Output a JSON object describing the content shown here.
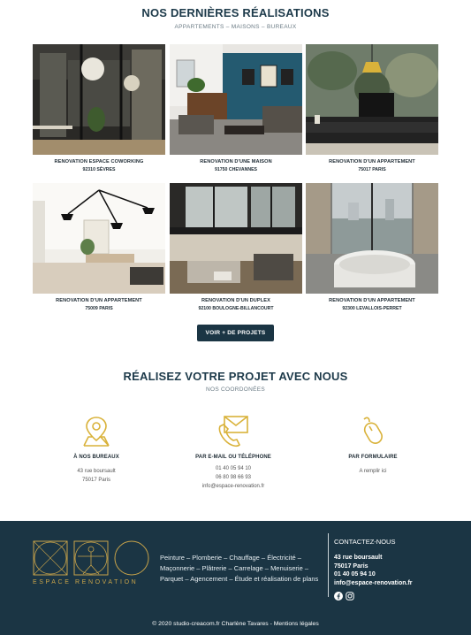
{
  "realisations": {
    "title": "NOS DERNIÈRES RÉALISATIONS",
    "subtitle": "APPARTEMENTS – MAISONS – BUREAUX",
    "projects": [
      {
        "title": "RENOVATION ESPACE COWORKING",
        "location": "92310 SÈVRES"
      },
      {
        "title": "RENOVATION D'UNE MAISON",
        "location": "91750 CHEVANNES"
      },
      {
        "title": "RENOVATION D'UN APPARTEMENT",
        "location": "75017 PARIS"
      },
      {
        "title": "RENOVATION D'UN APPARTEMENT",
        "location": "75009 PARIS"
      },
      {
        "title": "RENOVATION D'UN DUPLEX",
        "location": "92100 BOULOGNE-BILLANCOURT"
      },
      {
        "title": "RENOVATION D'UN APPARTEMENT",
        "location": "92300 LEVALLOIS-PERRET"
      }
    ],
    "more_button": "VOIR + DE PROJETS"
  },
  "projet": {
    "title": "RÉALISEZ VOTRE PROJET AVEC NOUS",
    "subtitle": "NOS COORDONÉES",
    "bureaux": {
      "heading": "À NOS BUREAUX",
      "line1": "43 rue boursault",
      "line2": "75017 Paris"
    },
    "email_tel": {
      "heading": "PAR E-MAIL OU TÉLÉPHONE",
      "phone1": "01 40 05 94 10",
      "phone2": "06 80 98 66 93",
      "email": "info@espace-renovation.fr"
    },
    "formulaire": {
      "heading": "PAR FORMULAIRE",
      "line1": "A remplir ici"
    }
  },
  "footer": {
    "logo_text": "ESPACE RENOVATION",
    "description": "Peinture – Plomberie – Chauffage – Électricité – Maçonnerie – Plâtrerie – Carrelage – Menuiserie – Parquet – Agencement – Étude et réalisation de plans",
    "contact_title": "CONTACTEZ-NOUS",
    "contact_address1": "43 rue boursault",
    "contact_address2": "75017 Paris",
    "contact_phone": "01 40 05 94 10",
    "contact_email": "info@espace-renovation.fr",
    "copyright": "© 2020 studio-creacom.fr Charlène Tavares - Mentions légales"
  },
  "colors": {
    "navy": "#1b3544",
    "gold": "#d9b23a",
    "title": "#1d3a4a"
  },
  "icons": [
    "map-pin-icon",
    "phone-mail-icon",
    "mouse-icon",
    "facebook-icon",
    "instagram-icon"
  ]
}
